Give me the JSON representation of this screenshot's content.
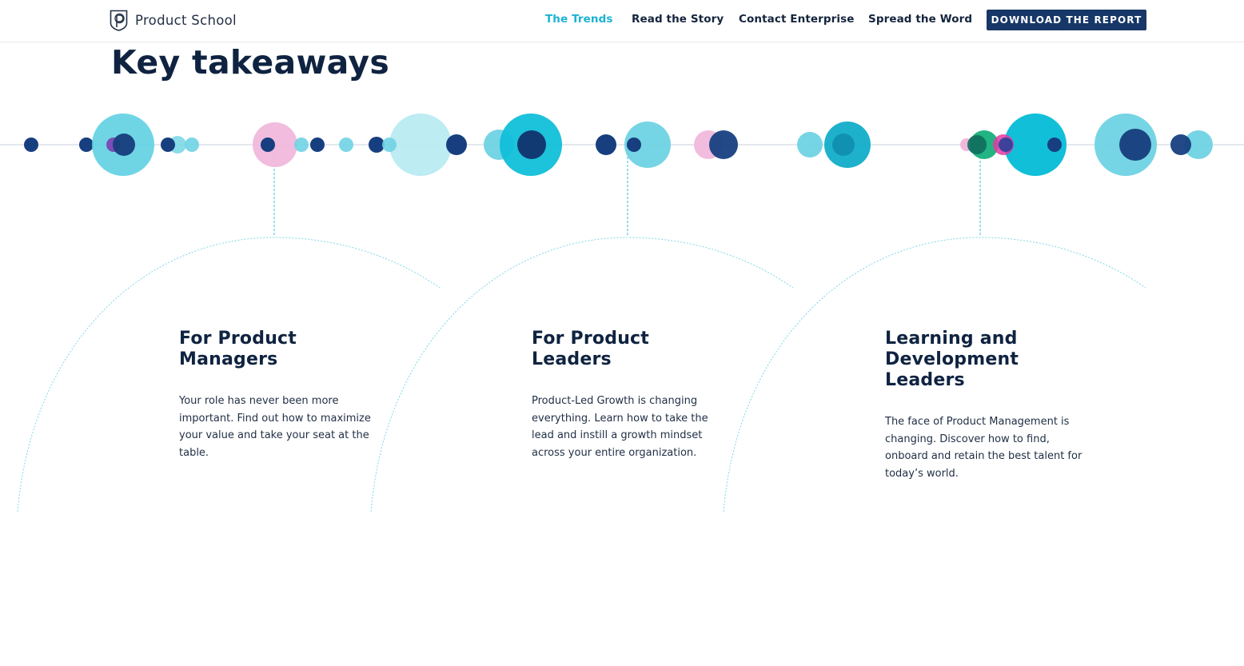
{
  "header": {
    "brand": "Product School",
    "brand_icon": "product-school-logo-icon",
    "nav": [
      {
        "label": "The Trends",
        "active": true
      },
      {
        "label": "Read the Story",
        "active": false
      },
      {
        "label": "Contact Enterprise",
        "active": false
      },
      {
        "label": "Spread the Word",
        "active": false
      }
    ],
    "cta_label": "DOWNLOAD THE REPORT"
  },
  "section": {
    "title": "Key takeaways"
  },
  "cards": [
    {
      "title": "For Product Managers",
      "body": "Your role has never been more important. Find out how to maximize your value and take your seat at the table."
    },
    {
      "title": "For Product Leaders",
      "body": "Product-Led Growth is changing everything. Learn how to take the lead and instill a growth mindset across your entire organization."
    },
    {
      "title": "Learning and Development Leaders",
      "body": "The face of Product Management is changing. Discover how to find, onboard and retain the best talent for today’s world."
    }
  ],
  "colors": {
    "navy": "#163767",
    "dark_text": "#0f2341",
    "accent_cyan": "#1ab3d4",
    "light_cyan": "#6fd3e3",
    "pale_cyan": "#b9ebf2",
    "pink": "#f0b8dc",
    "green": "#16b07c",
    "magenta": "#e23ba3"
  }
}
